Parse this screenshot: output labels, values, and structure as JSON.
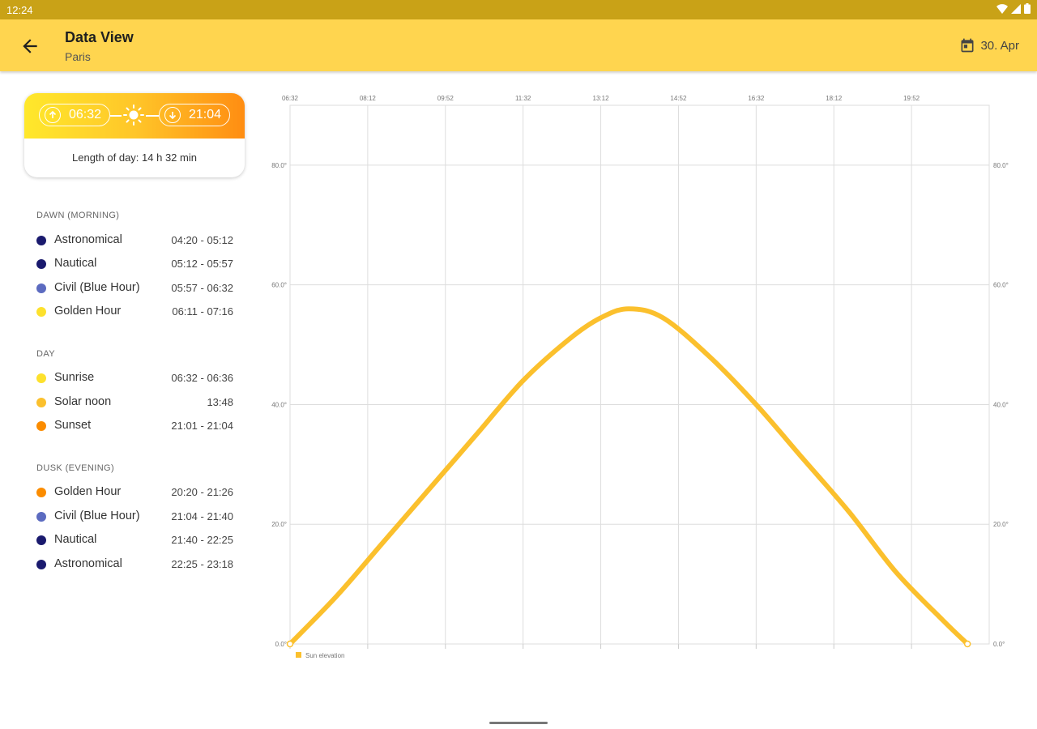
{
  "status_bar": {
    "time": "12:24"
  },
  "app_bar": {
    "title": "Data View",
    "subtitle": "Paris",
    "date": "30. Apr"
  },
  "sun_card": {
    "sunrise": "06:32",
    "sunset": "21:04",
    "day_length": "Length of day: 14 h 32 min"
  },
  "sections": [
    {
      "title": "DAWN (MORNING)",
      "items": [
        {
          "name": "Astronomical",
          "range": "04:20 - 05:12",
          "color": "#1a1a6e"
        },
        {
          "name": "Nautical",
          "range": "05:12 - 05:57",
          "color": "#1a1a6e"
        },
        {
          "name": "Civil (Blue Hour)",
          "range": "05:57 - 06:32",
          "color": "#5c6bc0"
        },
        {
          "name": "Golden Hour",
          "range": "06:11 - 07:16",
          "color": "#fde12d"
        }
      ]
    },
    {
      "title": "DAY",
      "items": [
        {
          "name": "Sunrise",
          "range": "06:32 - 06:36",
          "color": "#fde12d"
        },
        {
          "name": "Solar noon",
          "range": "13:48",
          "color": "#fbc02d"
        },
        {
          "name": "Sunset",
          "range": "21:01 - 21:04",
          "color": "#fb8c00"
        }
      ]
    },
    {
      "title": "DUSK (EVENING)",
      "items": [
        {
          "name": "Golden Hour",
          "range": "20:20 - 21:26",
          "color": "#fb8c00"
        },
        {
          "name": "Civil (Blue Hour)",
          "range": "21:04 - 21:40",
          "color": "#5c6bc0"
        },
        {
          "name": "Nautical",
          "range": "21:40 - 22:25",
          "color": "#1a1a6e"
        },
        {
          "name": "Astronomical",
          "range": "22:25 - 23:18",
          "color": "#1a1a6e"
        }
      ]
    }
  ],
  "chart_data": {
    "type": "line",
    "x_tick_labels": [
      "06:32",
      "08:12",
      "09:52",
      "11:32",
      "13:12",
      "14:52",
      "16:32",
      "18:12",
      "19:52"
    ],
    "y_tick_labels": [
      "0.0°",
      "20.0°",
      "40.0°",
      "60.0°",
      "80.0°"
    ],
    "ylim": [
      0,
      90
    ],
    "grid": true,
    "legend_position": "bottom-left",
    "series": [
      {
        "name": "Sun elevation",
        "color": "#fbc02d",
        "x": [
          "06:32",
          "07:32",
          "08:32",
          "09:32",
          "10:32",
          "11:32",
          "12:32",
          "13:12",
          "13:48",
          "14:32",
          "15:32",
          "16:32",
          "17:32",
          "18:32",
          "19:32",
          "20:32",
          "21:04"
        ],
        "values": [
          0,
          8,
          17,
          26,
          35,
          44,
          51,
          54.5,
          56,
          54.5,
          48,
          40,
          31,
          22,
          12,
          4,
          0
        ]
      }
    ]
  }
}
